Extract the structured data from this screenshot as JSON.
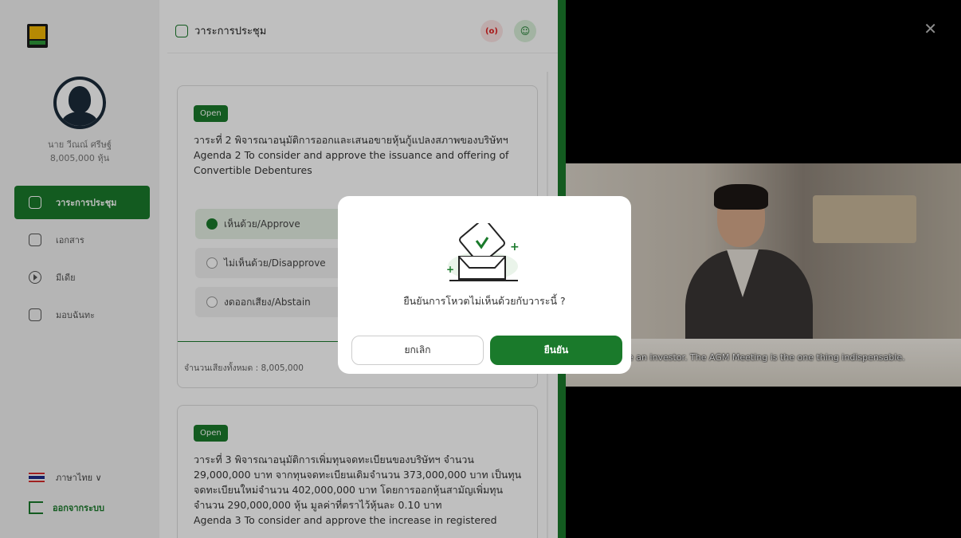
{
  "sidebar": {
    "user_name": "นาย วีณณ์ ศรีษฐ์",
    "user_shares": "8,005,000 หุ้น",
    "nav": [
      {
        "label": "วาระการประชุม",
        "icon": "agenda-icon"
      },
      {
        "label": "เอกสาร",
        "icon": "folder-icon"
      },
      {
        "label": "มีเดีย",
        "icon": "play-icon"
      },
      {
        "label": "มอบฉันทะ",
        "icon": "proxy-icon"
      }
    ],
    "language": "ภาษาไทย ∨",
    "logout": "ออกจากระบบ"
  },
  "main": {
    "title": "วาระการประชุม",
    "live_label": "(o)",
    "chat_label": "☺",
    "agenda1": {
      "status": "Open",
      "text_th": "วาระที่ 2 พิจารณาอนุมัติการออกและเสนอขายหุ้นกู้แปลงสภาพของบริษัทฯ",
      "text_en": "Agenda 2 To consider and approve the issuance and offering of Convertible Debentures",
      "options": [
        "เห็นด้วย/Approve",
        "ไม่เห็นด้วย/Disapprove",
        "งดออกเสียง/Abstain"
      ],
      "total": "จำนวนเสียงทั้งหมด : 8,005,000"
    },
    "agenda2": {
      "status": "Open",
      "text": "วาระที่ 3 พิจารณาอนุมัติการเพิ่มทุนจดทะเบียนของบริษัทฯ จำนวน 29,000,000 บาท จากทุนจดทะเบียนเดิมจำนวน 373,000,000 บาท เป็นทุนจดทะเบียนใหม่จำนวน 402,000,000 บาท โดยการออกหุ้นสามัญเพิ่มทุนจำนวน 290,000,000 หุ้น มูลค่าที่ตราไว้หุ้นละ 0.10 บาท",
      "text_en": "Agenda 3 To consider and approve the increase in registered"
    }
  },
  "video": {
    "close": "✕",
    "subtitle": "e an investor. The AGM Meeting is the one thing indispensable."
  },
  "modal": {
    "question": "ยืนยันการโหวตไม่เห็นด้วยกับวาระนี้ ?",
    "cancel": "ยกเลิก",
    "confirm": "ยืนยัน"
  },
  "colors": {
    "accent": "#1a7a2b",
    "live": "#e02020"
  }
}
